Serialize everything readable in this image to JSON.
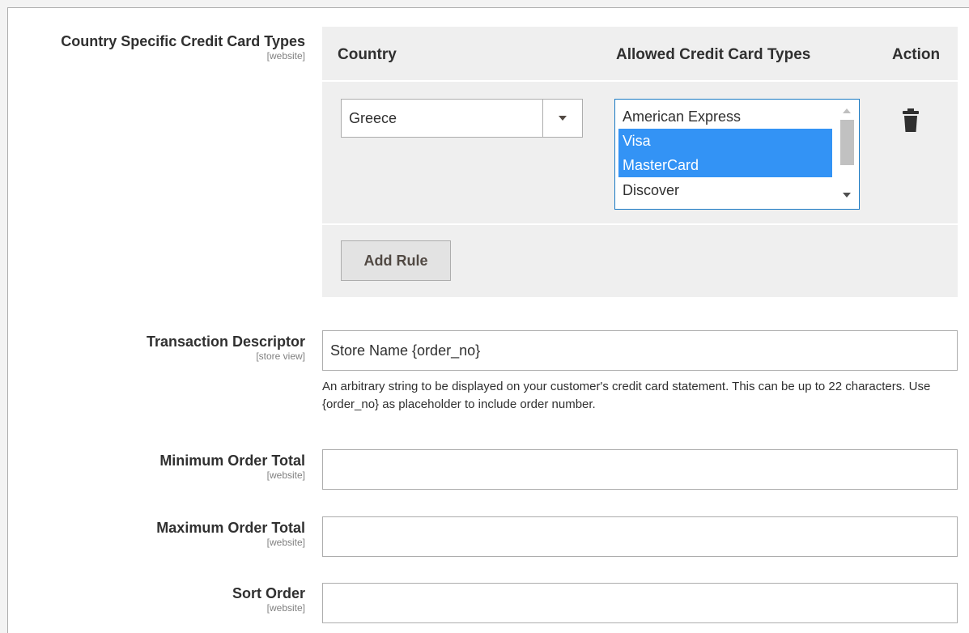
{
  "country_cc": {
    "label": "Country Specific Credit Card Types",
    "scope": "[website]",
    "columns": {
      "country": "Country",
      "allowed": "Allowed Credit Card Types",
      "action": "Action"
    },
    "row": {
      "country_value": "Greece",
      "card_options": [
        {
          "label": "American Express",
          "selected": false
        },
        {
          "label": "Visa",
          "selected": true
        },
        {
          "label": "MasterCard",
          "selected": true
        },
        {
          "label": "Discover",
          "selected": false
        }
      ]
    },
    "add_rule_label": "Add Rule",
    "icons": {
      "dropdown": "chevron-down-icon",
      "delete": "trash-icon"
    }
  },
  "transaction_descriptor": {
    "label": "Transaction Descriptor",
    "scope": "[store view]",
    "value": "Store Name {order_no}",
    "note": "An arbitrary string to be displayed on your customer's credit card statement. This can be up to 22 characters. Use {order_no} as placeholder to include order number."
  },
  "minimum_order_total": {
    "label": "Minimum Order Total",
    "scope": "[website]",
    "value": ""
  },
  "maximum_order_total": {
    "label": "Maximum Order Total",
    "scope": "[website]",
    "value": ""
  },
  "sort_order": {
    "label": "Sort Order",
    "scope": "[website]",
    "value": ""
  },
  "colors": {
    "selected_option": "#3393f5",
    "focus_border": "#1979c3",
    "table_bg": "#efefef"
  }
}
